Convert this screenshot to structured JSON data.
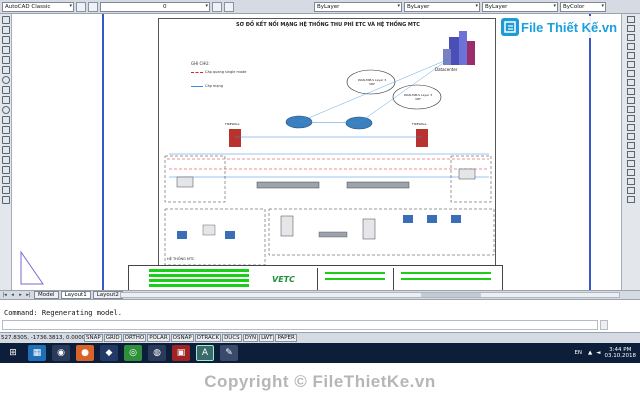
{
  "toolbar": {
    "workspace": "AutoCAD Classic",
    "layer_value": "0",
    "color": "ByLayer",
    "linetype": "ByLayer",
    "lineweight": "ByLayer",
    "plotstyle": "ByColor"
  },
  "watermark": {
    "brand": "File Thiết Kế.vn"
  },
  "drawing": {
    "title": "SƠ ĐỒ KẾT NỐI MẠNG HỆ THỐNG THU PHÍ ETC VÀ HỆ THỐNG MTC",
    "legend_title": "GHI CHÚ:",
    "legend_items": [
      "Cáp quang single mode",
      "Cáp mạng"
    ],
    "datacenter_label": "Datacenter",
    "cloud1": "WAN-MPLS Layer 3 VRF",
    "cloud2": "WAN-MPLS Layer 3 VRF",
    "firewall_left": "FIREWALL",
    "firewall_right": "FIREWALL",
    "system_label": "HỆ THỐNG MTC",
    "logo": "VETC"
  },
  "tabs": [
    "Model",
    "Layout1",
    "Layout2"
  ],
  "command": {
    "last_message": "Command: Regenerating model."
  },
  "status": {
    "coordinates": "527.8305, -1736.3813, 0.0000",
    "buttons": [
      "SNAP",
      "GRID",
      "ORTHO",
      "POLAR",
      "OSNAP",
      "OTRACK",
      "DUCS",
      "DYN",
      "LWT",
      "PAPER"
    ]
  },
  "taskbar": {
    "language": "EN",
    "time": "3:44 PM",
    "date": "03.10.2018"
  },
  "footer": {
    "copyright": "Copyright © FileThietKe.vn"
  },
  "colors": {
    "toolbar_bg": "#d6dbe3",
    "taskbar_bg": "#0d1e3a",
    "accent_blue": "#3a57c8",
    "legend_red": "#d22",
    "legend_blue": "#3a8de0",
    "green_text": "#18d018"
  }
}
